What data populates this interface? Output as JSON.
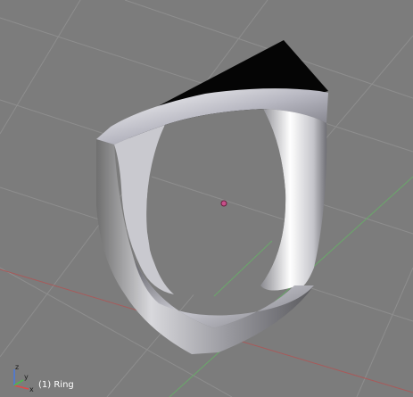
{
  "viewport": {
    "object_label": "(1) Ring",
    "background_color": "#7c7c7c",
    "grid_color": "#8e8e8e",
    "x_axis_color": "#a85a5a",
    "y_axis_color": "#6aa86a",
    "object_origin_color": "#c8508a",
    "mesh_material": "metallic-silver",
    "view": "perspective"
  },
  "axis_gizmo": {
    "x_label": "x",
    "y_label": "y",
    "z_label": "z",
    "x_color": "#e04848",
    "y_color": "#48c048",
    "z_color": "#4878e0"
  }
}
